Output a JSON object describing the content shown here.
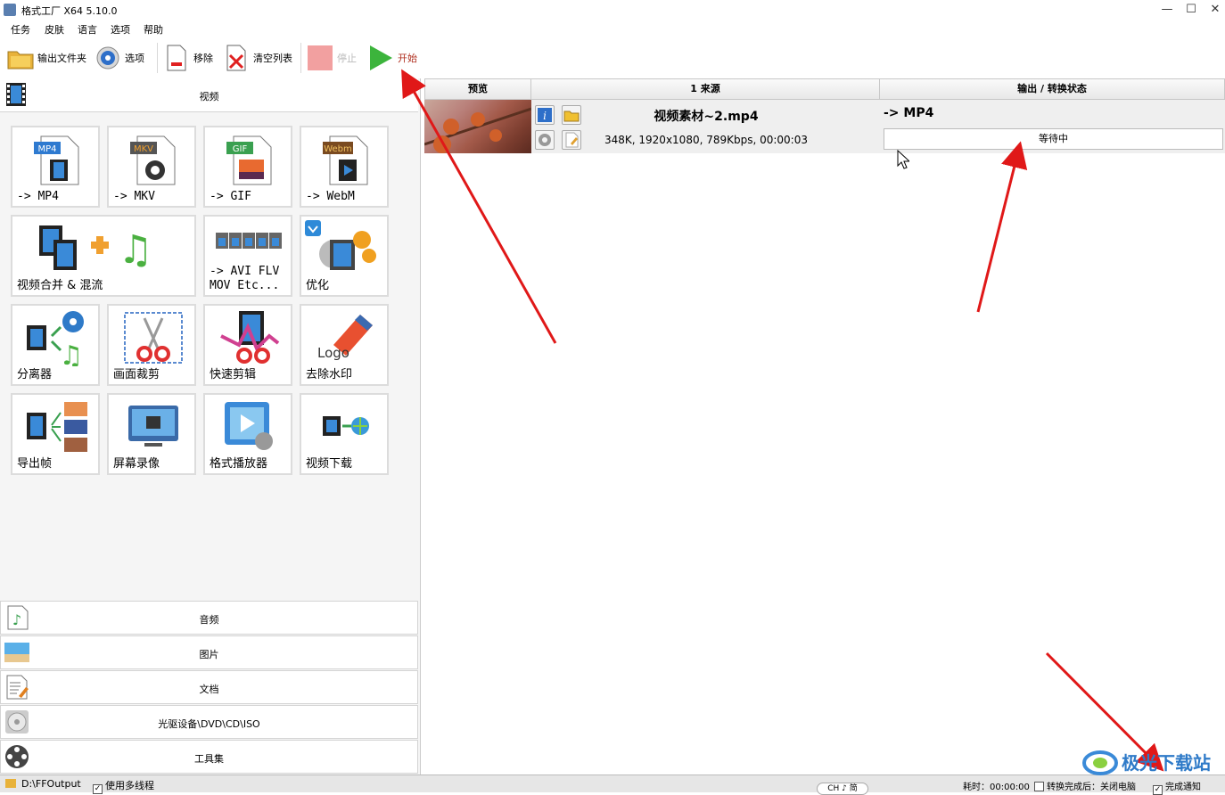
{
  "window": {
    "title": "格式工厂 X64 5.10.0",
    "min": "—",
    "max": "☐",
    "close": "✕"
  },
  "menu": [
    "任务",
    "皮肤",
    "语言",
    "选项",
    "帮助"
  ],
  "toolbar": {
    "output_folder": "输出文件夹",
    "options": "选项",
    "remove": "移除",
    "clear_list": "清空列表",
    "stop": "停止",
    "start": "开始"
  },
  "sidebar": {
    "video_label": "视频",
    "tiles": [
      {
        "label": "-> MP4",
        "badge": "MP4"
      },
      {
        "label": "-> MKV",
        "badge": "MKV"
      },
      {
        "label": "-> GIF",
        "badge": "GIF"
      },
      {
        "label": "-> WebM",
        "badge": "Webm"
      },
      {
        "label": "视频合并 & 混流"
      },
      {
        "label": "-> AVI FLV\nMOV Etc..."
      },
      {
        "label": "优化"
      },
      {
        "label": "分离器"
      },
      {
        "label": "画面裁剪"
      },
      {
        "label": "快速剪辑"
      },
      {
        "label": "去除水印",
        "logo": "Logo"
      },
      {
        "label": "导出帧"
      },
      {
        "label": "屏幕录像"
      },
      {
        "label": "格式播放器"
      },
      {
        "label": "视频下载"
      }
    ],
    "categories": [
      "音频",
      "图片",
      "文档",
      "光驱设备\\DVD\\CD\\ISO",
      "工具集"
    ]
  },
  "list": {
    "headers": {
      "preview": "预览",
      "source": "1 来源",
      "output": "输出 / 转换状态"
    },
    "rows": [
      {
        "filename": "视频素材~2.mp4",
        "info": "348K, 1920x1080, 789Kbps, 00:00:03",
        "output": "-> MP4",
        "status": "等待中"
      }
    ]
  },
  "statusbar": {
    "path": "D:\\FFOutput",
    "multithread": "使用多线程",
    "elapsed": "耗时：00:00:00",
    "after_done": "转换完成后：关闭电脑",
    "notify": "完成通知",
    "lang_pill": "CH ♪ 简"
  },
  "watermark": "极光下载站",
  "colors": {
    "start_green": "#3cb43c",
    "stop_red": "#f2a0a0",
    "arrow_red": "#e01818"
  }
}
